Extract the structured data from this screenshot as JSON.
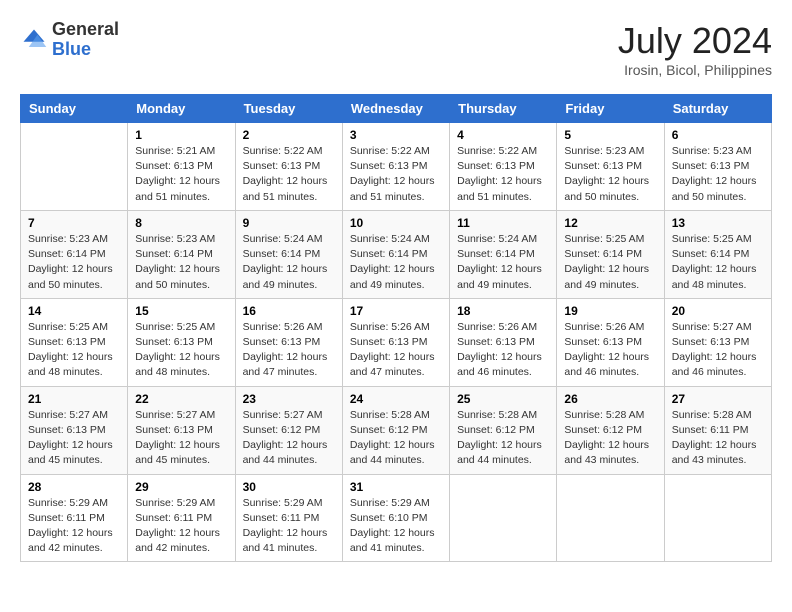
{
  "header": {
    "logo_general": "General",
    "logo_blue": "Blue",
    "month_year": "July 2024",
    "location": "Irosin, Bicol, Philippines"
  },
  "weekdays": [
    "Sunday",
    "Monday",
    "Tuesday",
    "Wednesday",
    "Thursday",
    "Friday",
    "Saturday"
  ],
  "weeks": [
    [
      {
        "day": "",
        "info": ""
      },
      {
        "day": "1",
        "info": "Sunrise: 5:21 AM\nSunset: 6:13 PM\nDaylight: 12 hours\nand 51 minutes."
      },
      {
        "day": "2",
        "info": "Sunrise: 5:22 AM\nSunset: 6:13 PM\nDaylight: 12 hours\nand 51 minutes."
      },
      {
        "day": "3",
        "info": "Sunrise: 5:22 AM\nSunset: 6:13 PM\nDaylight: 12 hours\nand 51 minutes."
      },
      {
        "day": "4",
        "info": "Sunrise: 5:22 AM\nSunset: 6:13 PM\nDaylight: 12 hours\nand 51 minutes."
      },
      {
        "day": "5",
        "info": "Sunrise: 5:23 AM\nSunset: 6:13 PM\nDaylight: 12 hours\nand 50 minutes."
      },
      {
        "day": "6",
        "info": "Sunrise: 5:23 AM\nSunset: 6:13 PM\nDaylight: 12 hours\nand 50 minutes."
      }
    ],
    [
      {
        "day": "7",
        "info": "Sunrise: 5:23 AM\nSunset: 6:14 PM\nDaylight: 12 hours\nand 50 minutes."
      },
      {
        "day": "8",
        "info": "Sunrise: 5:23 AM\nSunset: 6:14 PM\nDaylight: 12 hours\nand 50 minutes."
      },
      {
        "day": "9",
        "info": "Sunrise: 5:24 AM\nSunset: 6:14 PM\nDaylight: 12 hours\nand 49 minutes."
      },
      {
        "day": "10",
        "info": "Sunrise: 5:24 AM\nSunset: 6:14 PM\nDaylight: 12 hours\nand 49 minutes."
      },
      {
        "day": "11",
        "info": "Sunrise: 5:24 AM\nSunset: 6:14 PM\nDaylight: 12 hours\nand 49 minutes."
      },
      {
        "day": "12",
        "info": "Sunrise: 5:25 AM\nSunset: 6:14 PM\nDaylight: 12 hours\nand 49 minutes."
      },
      {
        "day": "13",
        "info": "Sunrise: 5:25 AM\nSunset: 6:14 PM\nDaylight: 12 hours\nand 48 minutes."
      }
    ],
    [
      {
        "day": "14",
        "info": "Sunrise: 5:25 AM\nSunset: 6:13 PM\nDaylight: 12 hours\nand 48 minutes."
      },
      {
        "day": "15",
        "info": "Sunrise: 5:25 AM\nSunset: 6:13 PM\nDaylight: 12 hours\nand 48 minutes."
      },
      {
        "day": "16",
        "info": "Sunrise: 5:26 AM\nSunset: 6:13 PM\nDaylight: 12 hours\nand 47 minutes."
      },
      {
        "day": "17",
        "info": "Sunrise: 5:26 AM\nSunset: 6:13 PM\nDaylight: 12 hours\nand 47 minutes."
      },
      {
        "day": "18",
        "info": "Sunrise: 5:26 AM\nSunset: 6:13 PM\nDaylight: 12 hours\nand 46 minutes."
      },
      {
        "day": "19",
        "info": "Sunrise: 5:26 AM\nSunset: 6:13 PM\nDaylight: 12 hours\nand 46 minutes."
      },
      {
        "day": "20",
        "info": "Sunrise: 5:27 AM\nSunset: 6:13 PM\nDaylight: 12 hours\nand 46 minutes."
      }
    ],
    [
      {
        "day": "21",
        "info": "Sunrise: 5:27 AM\nSunset: 6:13 PM\nDaylight: 12 hours\nand 45 minutes."
      },
      {
        "day": "22",
        "info": "Sunrise: 5:27 AM\nSunset: 6:13 PM\nDaylight: 12 hours\nand 45 minutes."
      },
      {
        "day": "23",
        "info": "Sunrise: 5:27 AM\nSunset: 6:12 PM\nDaylight: 12 hours\nand 44 minutes."
      },
      {
        "day": "24",
        "info": "Sunrise: 5:28 AM\nSunset: 6:12 PM\nDaylight: 12 hours\nand 44 minutes."
      },
      {
        "day": "25",
        "info": "Sunrise: 5:28 AM\nSunset: 6:12 PM\nDaylight: 12 hours\nand 44 minutes."
      },
      {
        "day": "26",
        "info": "Sunrise: 5:28 AM\nSunset: 6:12 PM\nDaylight: 12 hours\nand 43 minutes."
      },
      {
        "day": "27",
        "info": "Sunrise: 5:28 AM\nSunset: 6:11 PM\nDaylight: 12 hours\nand 43 minutes."
      }
    ],
    [
      {
        "day": "28",
        "info": "Sunrise: 5:29 AM\nSunset: 6:11 PM\nDaylight: 12 hours\nand 42 minutes."
      },
      {
        "day": "29",
        "info": "Sunrise: 5:29 AM\nSunset: 6:11 PM\nDaylight: 12 hours\nand 42 minutes."
      },
      {
        "day": "30",
        "info": "Sunrise: 5:29 AM\nSunset: 6:11 PM\nDaylight: 12 hours\nand 41 minutes."
      },
      {
        "day": "31",
        "info": "Sunrise: 5:29 AM\nSunset: 6:10 PM\nDaylight: 12 hours\nand 41 minutes."
      },
      {
        "day": "",
        "info": ""
      },
      {
        "day": "",
        "info": ""
      },
      {
        "day": "",
        "info": ""
      }
    ]
  ]
}
